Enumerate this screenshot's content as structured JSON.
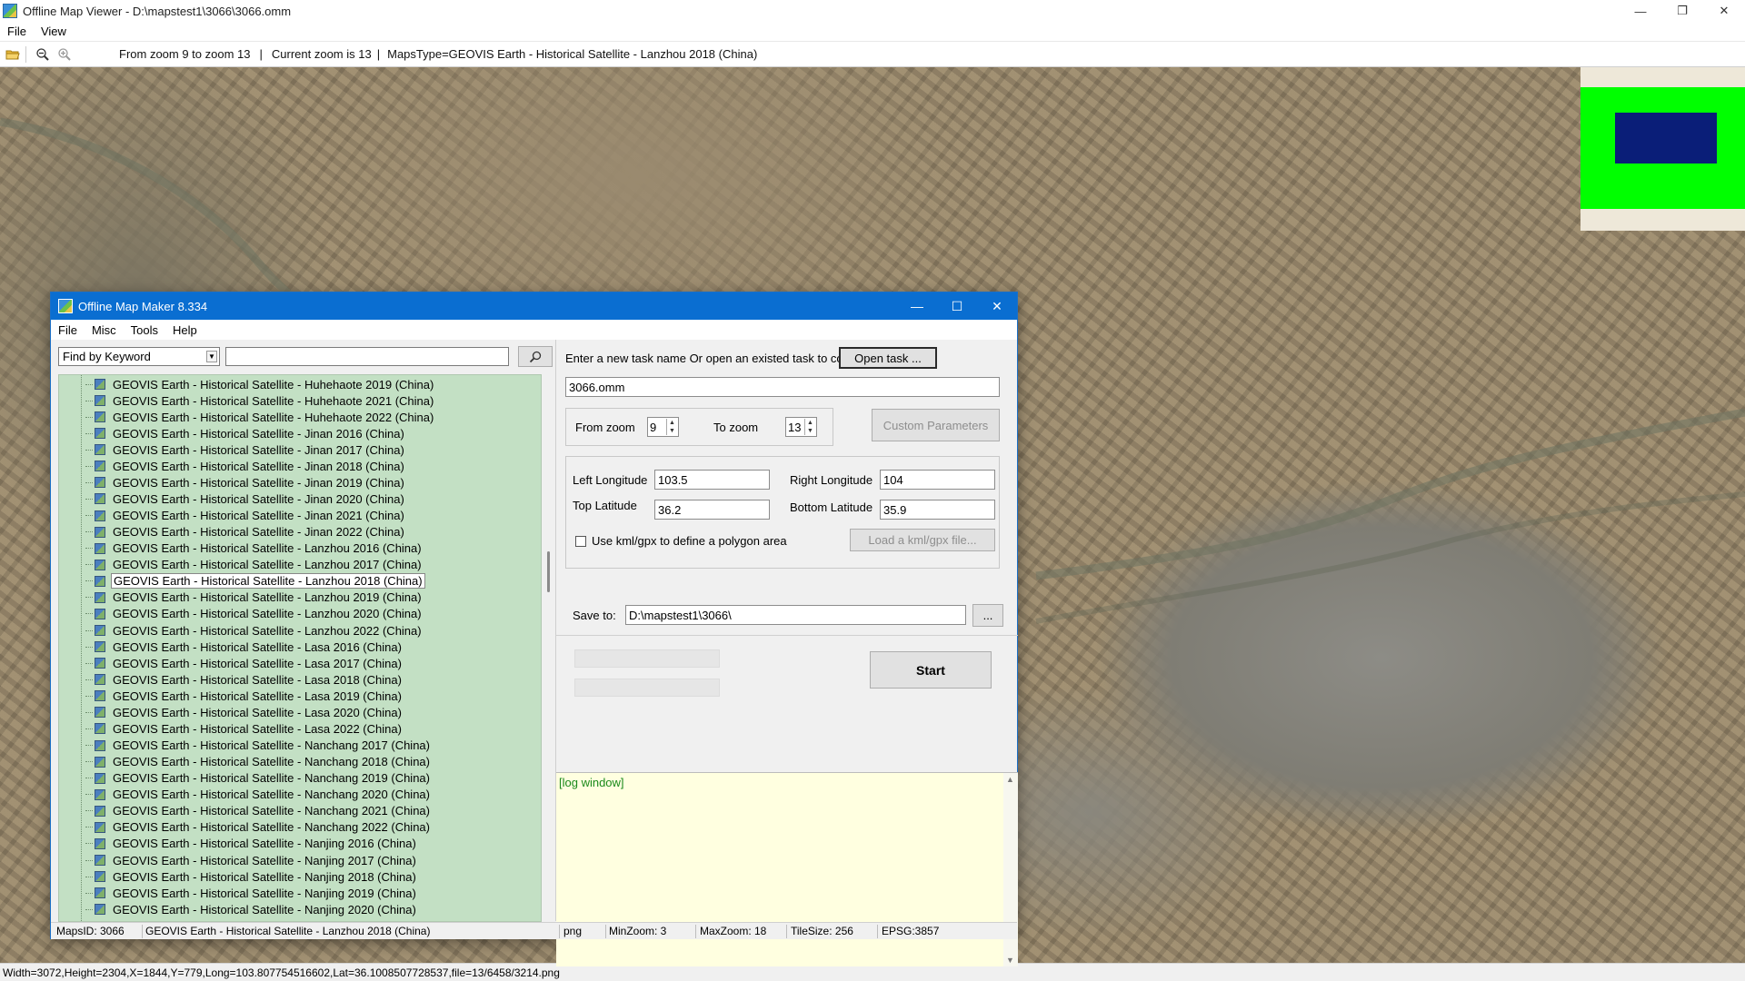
{
  "window": {
    "title": "Offline Map Viewer - D:\\mapstest1\\3066\\3066.omm",
    "menu": [
      "File",
      "View"
    ],
    "controls": {
      "minimize": "—",
      "maximize": "❐",
      "close": "✕"
    }
  },
  "toolbar": {
    "zoom_range": "From zoom 9 to zoom 13",
    "current_zoom": "Current zoom is 13",
    "maps_type": "MapsType=GEOVIS Earth - Historical Satellite - Lanzhou 2018 (China)",
    "separator": "|"
  },
  "map_status": "Width=3072,Height=2304,X=1844,Y=779,Long=103.807754516602,Lat=36.1008507728537,file=13/6458/3214.png",
  "minimap": {
    "colors": {
      "background": "#00ff00",
      "viewport": "#0a1e78"
    }
  },
  "dialog": {
    "title": "Offline Map Maker 8.334",
    "menu": [
      "File",
      "Misc",
      "Tools",
      "Help"
    ],
    "search": {
      "mode": "Find by Keyword",
      "keyword": ""
    },
    "tree_items": [
      "GEOVIS Earth - Historical Satellite - Huhehaote 2019 (China)",
      "GEOVIS Earth - Historical Satellite - Huhehaote 2021 (China)",
      "GEOVIS Earth - Historical Satellite - Huhehaote 2022 (China)",
      "GEOVIS Earth - Historical Satellite - Jinan 2016 (China)",
      "GEOVIS Earth - Historical Satellite - Jinan 2017 (China)",
      "GEOVIS Earth - Historical Satellite - Jinan 2018 (China)",
      "GEOVIS Earth - Historical Satellite - Jinan 2019 (China)",
      "GEOVIS Earth - Historical Satellite - Jinan 2020 (China)",
      "GEOVIS Earth - Historical Satellite - Jinan 2021 (China)",
      "GEOVIS Earth - Historical Satellite - Jinan 2022 (China)",
      "GEOVIS Earth - Historical Satellite - Lanzhou 2016 (China)",
      "GEOVIS Earth - Historical Satellite - Lanzhou 2017 (China)",
      "GEOVIS Earth - Historical Satellite - Lanzhou 2018 (China)",
      "GEOVIS Earth - Historical Satellite - Lanzhou 2019 (China)",
      "GEOVIS Earth - Historical Satellite - Lanzhou 2020 (China)",
      "GEOVIS Earth - Historical Satellite - Lanzhou 2022 (China)",
      "GEOVIS Earth - Historical Satellite - Lasa 2016 (China)",
      "GEOVIS Earth - Historical Satellite - Lasa 2017 (China)",
      "GEOVIS Earth - Historical Satellite - Lasa 2018 (China)",
      "GEOVIS Earth - Historical Satellite - Lasa 2019 (China)",
      "GEOVIS Earth - Historical Satellite - Lasa 2020 (China)",
      "GEOVIS Earth - Historical Satellite - Lasa 2022 (China)",
      "GEOVIS Earth - Historical Satellite - Nanchang 2017 (China)",
      "GEOVIS Earth - Historical Satellite - Nanchang 2018 (China)",
      "GEOVIS Earth - Historical Satellite - Nanchang 2019 (China)",
      "GEOVIS Earth - Historical Satellite - Nanchang 2020 (China)",
      "GEOVIS Earth - Historical Satellite - Nanchang 2021 (China)",
      "GEOVIS Earth - Historical Satellite - Nanchang 2022 (China)",
      "GEOVIS Earth - Historical Satellite - Nanjing 2016 (China)",
      "GEOVIS Earth - Historical Satellite - Nanjing 2017 (China)",
      "GEOVIS Earth - Historical Satellite - Nanjing 2018 (China)",
      "GEOVIS Earth - Historical Satellite - Nanjing 2019 (China)",
      "GEOVIS Earth - Historical Satellite - Nanjing 2020 (China)"
    ],
    "selected_item": "GEOVIS Earth - Historical Satellite - Lanzhou 2018 (China)",
    "task": {
      "prompt": "Enter a new task name Or open an existed task to continue:",
      "open_label": "Open task ...",
      "name": "3066.omm"
    },
    "zoom": {
      "from_label": "From zoom",
      "from": "9",
      "to_label": "To zoom",
      "to": "13",
      "custom_label": "Custom Parameters"
    },
    "bounds": {
      "left_lon_label": "Left Longitude",
      "left_lon": "103.5",
      "right_lon_label": "Right Longitude",
      "right_lon": "104",
      "top_lat_label": "Top Latitude",
      "top_lat": "36.2",
      "bottom_lat_label": "Bottom Latitude",
      "bottom_lat": "35.9"
    },
    "kml": {
      "label": "Use kml/gpx to define a polygon area",
      "load_label": "Load a kml/gpx file..."
    },
    "save": {
      "label": "Save to:",
      "path": "D:\\mapstest1\\3066\\",
      "browse": "..."
    },
    "start_label": "Start",
    "log_placeholder": "[log window]",
    "status": {
      "maps_id": "MapsID: 3066",
      "maps_name": "GEOVIS Earth - Historical Satellite - Lanzhou 2018 (China)",
      "format": "png",
      "min_zoom": "MinZoom: 3",
      "max_zoom": "MaxZoom: 18",
      "tile_size": "TileSize: 256",
      "epsg": "EPSG:3857"
    }
  }
}
